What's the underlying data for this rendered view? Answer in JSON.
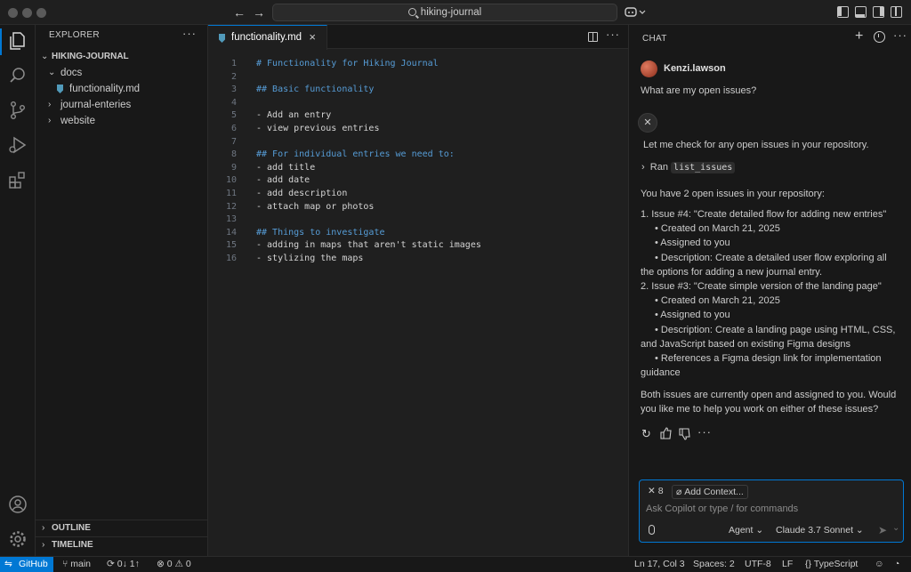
{
  "window": {
    "search_text": "hiking-journal"
  },
  "explorer": {
    "title": "EXPLORER",
    "more": "···",
    "root": "HIKING-JOURNAL",
    "items": [
      {
        "label": "docs",
        "type": "folder-open"
      },
      {
        "label": "functionality.md",
        "type": "file"
      },
      {
        "label": "journal-enteries",
        "type": "folder"
      },
      {
        "label": "website",
        "type": "folder"
      }
    ],
    "outline": "OUTLINE",
    "timeline": "TIMELINE"
  },
  "editor": {
    "tab_label": "functionality.md",
    "lines": [
      {
        "n": "1",
        "t": "# Functionality for Hiking Journal",
        "heading": true
      },
      {
        "n": "2",
        "t": "",
        "heading": false
      },
      {
        "n": "3",
        "t": "## Basic functionality",
        "heading": true
      },
      {
        "n": "4",
        "t": "",
        "heading": false
      },
      {
        "n": "5",
        "t": "- Add an entry",
        "heading": false
      },
      {
        "n": "6",
        "t": "- view previous entries",
        "heading": false
      },
      {
        "n": "7",
        "t": "",
        "heading": false
      },
      {
        "n": "8",
        "t": "## For individual entries we need to:",
        "heading": true
      },
      {
        "n": "9",
        "t": "- add title",
        "heading": false
      },
      {
        "n": "10",
        "t": "- add date",
        "heading": false
      },
      {
        "n": "11",
        "t": "- add description",
        "heading": false
      },
      {
        "n": "12",
        "t": "- attach map or photos",
        "heading": false
      },
      {
        "n": "13",
        "t": "",
        "heading": false
      },
      {
        "n": "14",
        "t": "## Things to investigate",
        "heading": true
      },
      {
        "n": "15",
        "t": "- adding in maps that aren't static images",
        "heading": false
      },
      {
        "n": "16",
        "t": "- stylizing the maps",
        "heading": false
      }
    ]
  },
  "chat": {
    "title": "CHAT",
    "user_name": "Kenzi.lawson",
    "user_message": "What are my open issues?",
    "bot_intro": "Let me check for any open issues in your repository.",
    "ran_label": "Ran",
    "ran_tool": "list_issues",
    "summary": "You have 2 open issues in your repository:",
    "issue1_title": "1. Issue #4: \"Create detailed flow for adding new entries\"",
    "issue1_b1": "• Created on March 21, 2025",
    "issue1_b2": "• Assigned to you",
    "issue1_b3a": "• Description: Create a detailed user flow exploring all",
    "issue1_b3b": "the options for adding a new journal entry.",
    "issue2_title": "2. Issue #3: \"Create simple version of the landing page\"",
    "issue2_b1": "• Created on March 21, 2025",
    "issue2_b2": "• Assigned to you",
    "issue2_b3a": "• Description: Create a landing page using HTML, CSS,",
    "issue2_b3b": "and JavaScript based on existing Figma designs",
    "issue2_b4a": "• References a Figma design link for implementation",
    "issue2_b4b": "guidance",
    "closing1": "Both issues are currently open and assigned to you. Would",
    "closing2": "you like me to help you work on either of these issues?",
    "tools_count": "8",
    "add_context": "Add Context...",
    "input_placeholder": "Ask Copilot or type / for commands",
    "mode": "Agent",
    "model": "Claude 3.7 Sonnet"
  },
  "status": {
    "remote": "GitHub",
    "branch": "main",
    "sync": "0↓ 1↑",
    "errors": "0",
    "warnings": "0",
    "position": "Ln 17, Col 3",
    "spaces": "Spaces: 2",
    "encoding": "UTF-8",
    "eol": "LF",
    "language": "TypeScript"
  },
  "colors": {
    "accent": "#0078d4",
    "heading": "#569cd6",
    "background": "#1f1f1f",
    "panel": "#181818"
  }
}
